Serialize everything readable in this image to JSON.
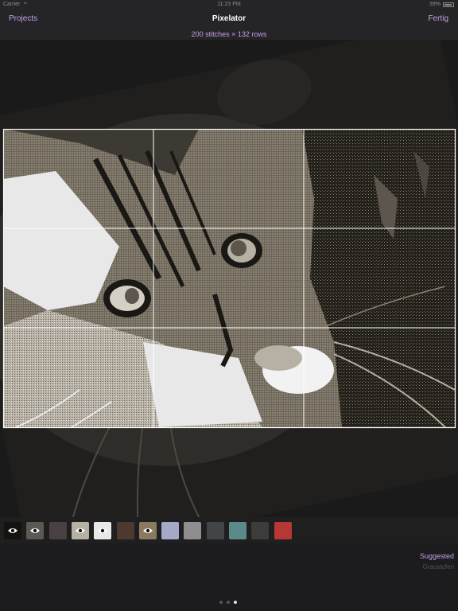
{
  "status_bar": {
    "carrier": "Carrier",
    "time": "11:23 PM",
    "battery": "39%"
  },
  "nav": {
    "left_button": "Projects",
    "title": "Pixelator",
    "right_button": "Fertig"
  },
  "dimensions_text": "200 stitches × 132 rows",
  "palette": [
    {
      "color": "#15130f",
      "visible_eye": true
    },
    {
      "color": "#5c5852",
      "visible_eye": true
    },
    {
      "color": "#4a3f44",
      "visible_eye": false
    },
    {
      "color": "#b7b0a4",
      "visible_eye": true
    },
    {
      "color": "#e8e8e8",
      "visible_eye": true
    },
    {
      "color": "#4c3a30",
      "visible_eye": false
    },
    {
      "color": "#8a7a60",
      "visible_eye": true
    },
    {
      "color": "#a3a9c6",
      "visible_eye": false
    },
    {
      "color": "#8e8e90",
      "visible_eye": false
    },
    {
      "color": "#434446",
      "visible_eye": false
    },
    {
      "color": "#5c8a88",
      "visible_eye": false
    },
    {
      "color": "#3d3c3b",
      "visible_eye": false
    },
    {
      "color": "#b53834",
      "visible_eye": false
    }
  ],
  "links": {
    "suggested": "Suggested",
    "grayscale": "Graustufen"
  },
  "pager": {
    "count": 3,
    "active_index": 2
  },
  "colors": {
    "accent": "#c89ee6",
    "background": "#1c1c1e",
    "grid_line": "#ffffff"
  },
  "image_icon": "pixelated-cat-photo"
}
